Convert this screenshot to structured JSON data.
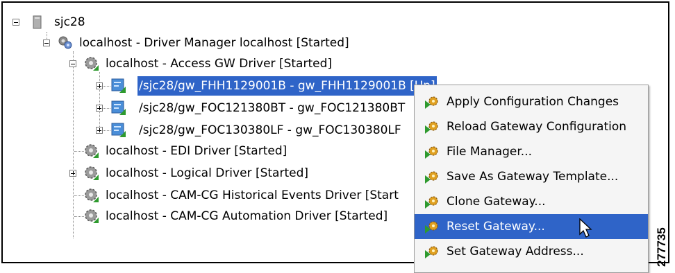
{
  "tree": {
    "root": {
      "label": "sjc28"
    },
    "driver_manager": {
      "label": "localhost - Driver Manager localhost [Started]"
    },
    "access_gw": {
      "label": "localhost - Access GW Driver [Started]"
    },
    "gateways": [
      {
        "label": "/sjc28/gw_FHH1129001B - gw_FHH1129001B [Up]",
        "selected": true
      },
      {
        "label": "/sjc28/gw_FOC121380BT - gw_FOC121380BT"
      },
      {
        "label": "/sjc28/gw_FOC130380LF - gw_FOC130380LF"
      }
    ],
    "drivers": [
      {
        "label": "localhost - EDI Driver [Started]"
      },
      {
        "label": "localhost - Logical Driver [Started]"
      },
      {
        "label": "localhost - CAM-CG Historical Events Driver [Start"
      },
      {
        "label": "localhost - CAM-CG Automation Driver [Started]"
      }
    ]
  },
  "context_menu": {
    "items": [
      {
        "label": "Apply Configuration Changes"
      },
      {
        "label": "Reload Gateway Configuration"
      },
      {
        "label": "File Manager..."
      },
      {
        "label": "Save As Gateway Template..."
      },
      {
        "label": "Clone Gateway..."
      },
      {
        "label": "Reset Gateway...",
        "active": true
      },
      {
        "label": "Set Gateway Address..."
      }
    ]
  },
  "watermark": "277735",
  "colors": {
    "selection": "#2f64c8",
    "menu_bg": "#f5f5f5",
    "gear": "#7a7a7a",
    "status_green": "#2e9a2e"
  }
}
